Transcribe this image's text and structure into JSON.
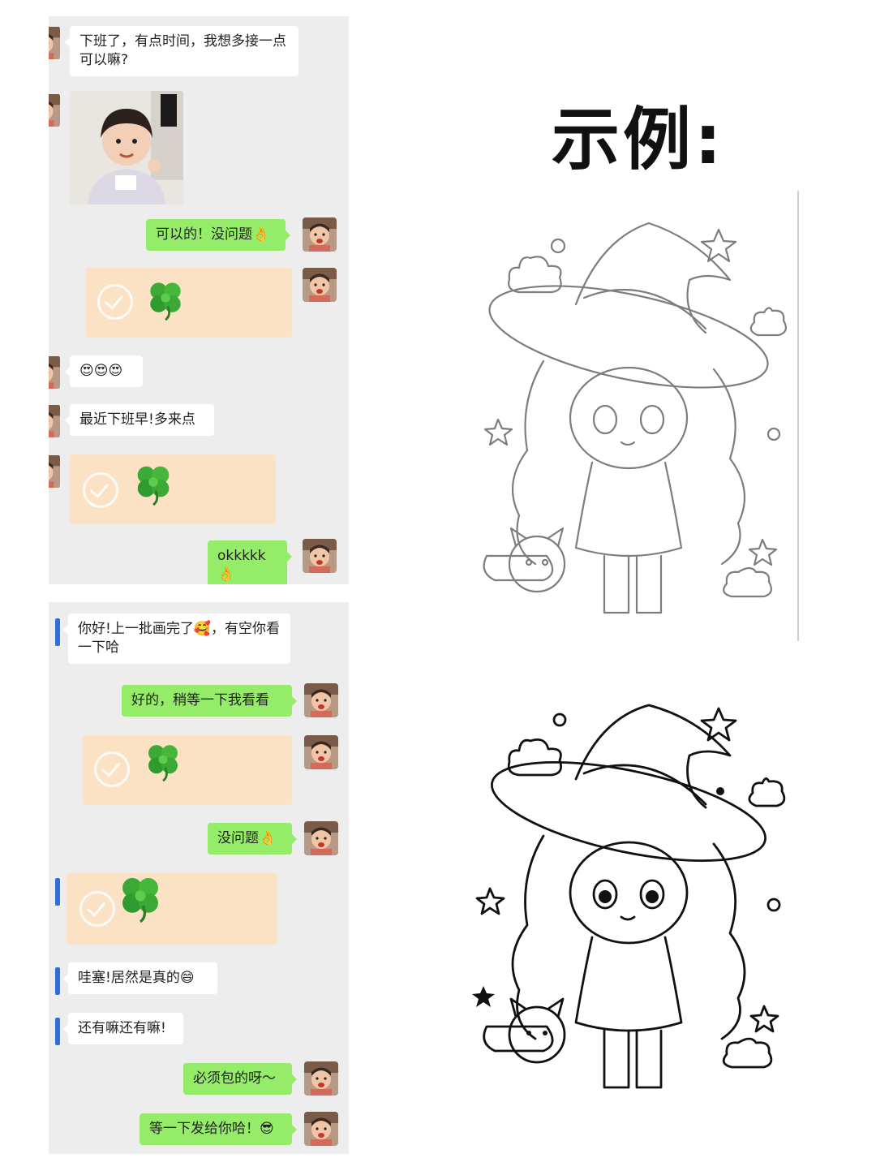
{
  "heading": "示例:",
  "chat1": {
    "messages": {
      "m1": "下班了，有点时间，我想多接一点可以嘛?",
      "m2": "可以的！没问题👌",
      "m3": "😍😍😍",
      "m4": "最近下班早!多来点",
      "m5": "okkkkk👌"
    }
  },
  "chat2": {
    "messages": {
      "m1": "你好!上一批画完了🥰，有空你看一下哈",
      "m2": "好的，稍等一下我看看",
      "m3": "没问题👌",
      "m4": "哇塞!居然是真的😄",
      "m5": "还有嘛还有嘛!",
      "m6": "必须包的呀～",
      "m7": "等一下发给你哈！😎"
    }
  },
  "icons": {
    "transfer_check": "check-circle-icon",
    "clover": "four-leaf-clover-icon"
  },
  "colors": {
    "incoming_bubble": "#ffffff",
    "outgoing_bubble": "#95ec69",
    "transfer_card": "#fbe2c4",
    "chat_bg": "#ededed",
    "side_marker": "#2f6fd6"
  },
  "artwork": [
    {
      "name": "witch-girl-sketch-grey",
      "style": "grey line art"
    },
    {
      "name": "witch-girl-lineart-black",
      "style": "black line art"
    }
  ]
}
